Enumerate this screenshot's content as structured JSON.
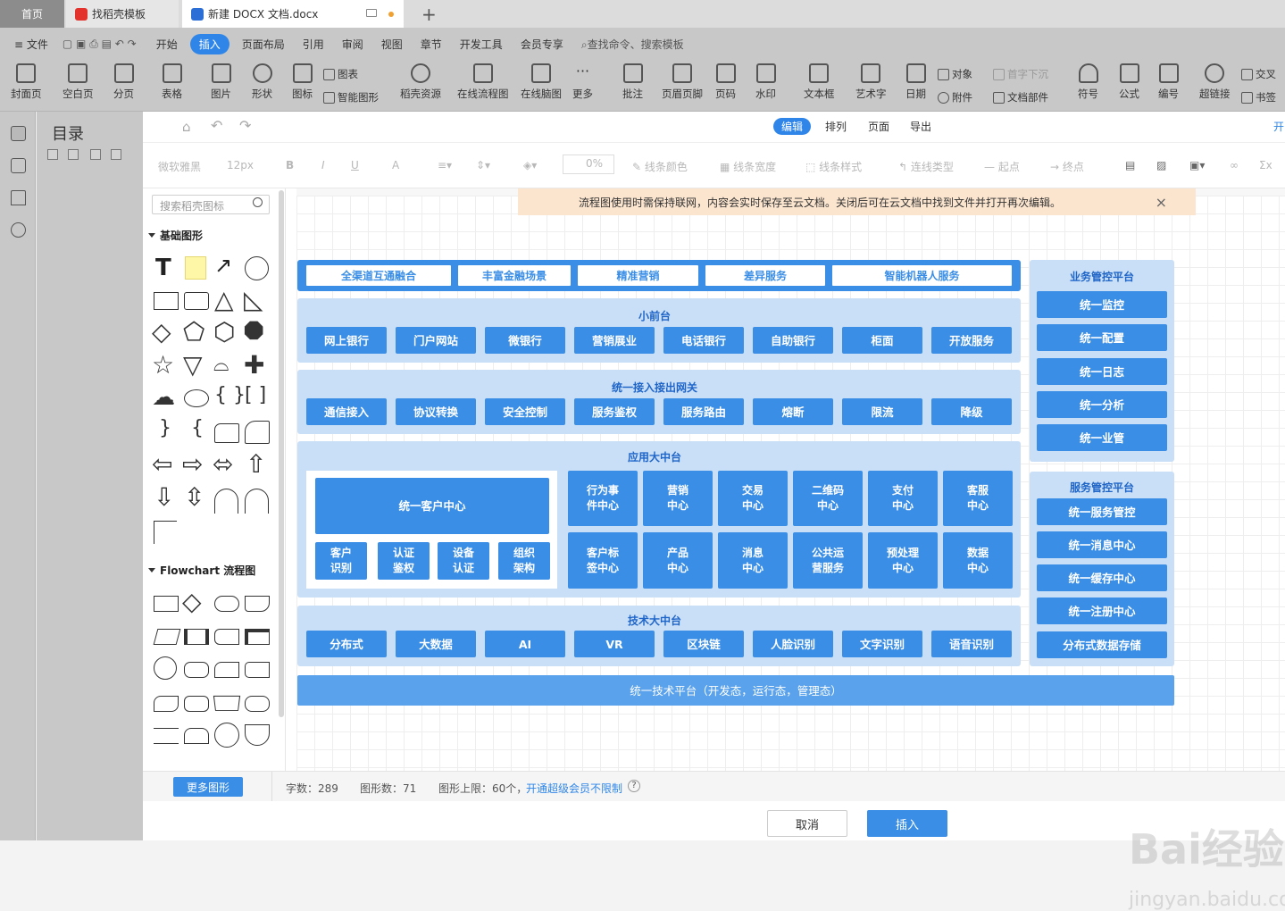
{
  "tabs": {
    "home": "首页",
    "template": "找稻壳模板",
    "doc": "新建 DOCX 文档.docx",
    "add": "+"
  },
  "menu": {
    "file": "文件",
    "items": [
      "开始",
      "插入",
      "页面布局",
      "引用",
      "审阅",
      "视图",
      "章节",
      "开发工具",
      "会员专享"
    ],
    "search": "查找命令、搜索模板"
  },
  "ribbon": {
    "buttons": [
      "封面页",
      "空白页",
      "分页",
      "表格",
      "图片",
      "形状",
      "图标",
      "稻壳资源",
      "在线流程图",
      "在线脑图",
      "更多",
      "批注",
      "页眉页脚",
      "页码",
      "水印",
      "文本框",
      "艺术字",
      "日期",
      "符号",
      "公式",
      "编号",
      "超链接"
    ],
    "small": [
      "图表",
      "智能图形",
      "对象",
      "首字下沉",
      "附件",
      "文档部件",
      "交叉",
      "书签"
    ]
  },
  "outline": {
    "title": "目录"
  },
  "dialog": {
    "tabs": {
      "edit": "编辑",
      "arrange": "排列",
      "page": "页面",
      "export": "导出",
      "open": "开"
    },
    "format": [
      "微软雅黑",
      "12px",
      "B",
      "I",
      "U",
      "A",
      "0%",
      "线条颜色",
      "线条宽度",
      "线条样式",
      "连线类型",
      "起点",
      "终点",
      "Σx"
    ],
    "search_placeholder": "搜索稻壳图标",
    "sections": {
      "basic": "基础图形",
      "flow": "Flowchart 流程图"
    },
    "notice": "流程图使用时需保持联网，内容会实时保存至云文档。关闭后可在云文档中找到文件并打开再次编辑。",
    "close": "×",
    "more_shapes": "更多图形",
    "status": {
      "chars": "字数：289",
      "shapes": "图形数：71",
      "limit": "图形上限：60个，",
      "link": "开通超级会员不限制",
      "help": "?"
    },
    "cancel": "取消",
    "insert": "插入"
  },
  "diagram": {
    "top_channels": [
      "全渠道互通融合",
      "丰富金融场景",
      "精准营销",
      "差异服务",
      "智能机器人服务"
    ],
    "small_front": {
      "title": "小前台",
      "items": [
        "网上银行",
        "门户网站",
        "微银行",
        "营销展业",
        "电话银行",
        "自助银行",
        "柜面",
        "开放服务"
      ]
    },
    "gateway": {
      "title": "统一接入接出网关",
      "items": [
        "通信接入",
        "协议转换",
        "安全控制",
        "服务鉴权",
        "服务路由",
        "熔断",
        "限流",
        "降级"
      ]
    },
    "app_center": {
      "title": "应用大中台",
      "customer_center": "统一客户中心",
      "customer_subs": [
        "客户\n识别",
        "认证\n鉴权",
        "设备\n认证",
        "组织\n架构"
      ],
      "row1": [
        "行为事\n件中心",
        "营销\n中心",
        "交易\n中心",
        "二维码\n中心",
        "支付\n中心",
        "客服\n中心"
      ],
      "row2": [
        "客户标\n签中心",
        "产品\n中心",
        "消息\n中心",
        "公共运\n营服务",
        "预处理\n中心",
        "数据\n中心"
      ]
    },
    "tech_center": {
      "title": "技术大中台",
      "items": [
        "分布式",
        "大数据",
        "AI",
        "VR",
        "区块链",
        "人脸识别",
        "文字识别",
        "语音识别"
      ]
    },
    "biz_platform": {
      "title": "业务管控平台",
      "items": [
        "统一监控",
        "统一配置",
        "统一日志",
        "统一分析",
        "统一业管"
      ]
    },
    "svc_platform": {
      "title": "服务管控平台",
      "items": [
        "统一服务管控",
        "统一消息中心",
        "统一缓存中心",
        "统一注册中心",
        "分布式数据存储"
      ]
    },
    "bottom": "统一技术平台（开发态，运行态，管理态）"
  },
  "watermark": {
    "main": "Bai经验",
    "sub": "jingyan.baidu.com"
  },
  "colors": {
    "accent": "#2f86e8",
    "box": "#3a8ee6",
    "band": "#c9dff7",
    "notice": "#fbe5cf"
  }
}
